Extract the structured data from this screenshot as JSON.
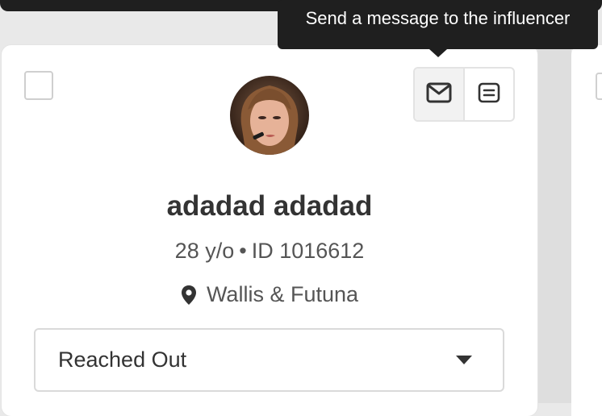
{
  "tooltip": {
    "text": "Send a message to the influencer"
  },
  "card": {
    "name": "adadad adadad",
    "age": "28 y/o",
    "separator": "•",
    "id_label": "ID 1016612",
    "location": "Wallis & Futuna",
    "status": {
      "selected": "Reached Out"
    },
    "actions": {
      "message_icon": "mail-icon",
      "notes_icon": "notes-icon"
    },
    "notification_color": "#3a5ef0"
  }
}
